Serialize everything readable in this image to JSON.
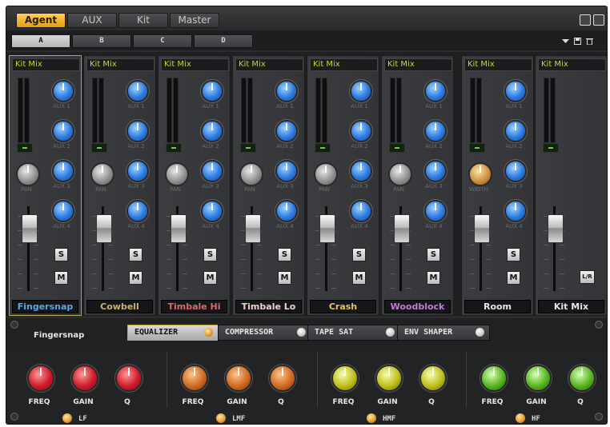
{
  "top_tabs": [
    {
      "label": "Agent",
      "active": true
    },
    {
      "label": "AUX",
      "active": false
    },
    {
      "label": "Kit",
      "active": false
    },
    {
      "label": "Master",
      "active": false
    }
  ],
  "scene_tabs": [
    {
      "label": "A",
      "active": true
    },
    {
      "label": "B",
      "active": false
    },
    {
      "label": "C",
      "active": false
    },
    {
      "label": "D",
      "active": false
    }
  ],
  "strip_header": "Kit Mix",
  "knob_labels": {
    "pan": "PAN",
    "width": "WIDTH",
    "aux1": "AUX 1",
    "aux2": "AUX 2",
    "aux3": "AUX 3",
    "aux4": "AUX 4"
  },
  "buttons": {
    "solo": "S",
    "mute": "M",
    "lr": "L/R"
  },
  "channels": [
    {
      "name": "Fingersnap",
      "color": "#5aa6e6"
    },
    {
      "name": "Cowbell",
      "color": "#c9b46a"
    },
    {
      "name": "Timbale Hi",
      "color": "#d86a6a"
    },
    {
      "name": "Timbale Lo",
      "color": "#f0d0d0"
    },
    {
      "name": "Crash",
      "color": "#e5c45a"
    },
    {
      "name": "Woodblock",
      "color": "#c47ad8"
    },
    {
      "name": "Room",
      "color": "#e6e6e6"
    },
    {
      "name": "Kit Mix",
      "color": "#e6e6e6"
    }
  ],
  "selected_channel": "Fingersnap",
  "insert_tabs": [
    {
      "label": "EQUALIZER",
      "active": true
    },
    {
      "label": "COMPRESSOR",
      "active": false
    },
    {
      "label": "TAPE SAT",
      "active": false
    },
    {
      "label": "ENV SHAPER",
      "active": false
    }
  ],
  "eq_knob_labels": {
    "freq": "FREQ",
    "gain": "GAIN",
    "q": "Q"
  },
  "eq_bands": [
    {
      "label": "LF",
      "color": "red"
    },
    {
      "label": "LMF",
      "color": "orange"
    },
    {
      "label": "HMF",
      "color": "yellow"
    },
    {
      "label": "HF",
      "color": "green"
    }
  ],
  "colors": {
    "accent": "#f0b13a",
    "aux_knob": "#2c7ae0",
    "header_text": "#c2d63a"
  }
}
